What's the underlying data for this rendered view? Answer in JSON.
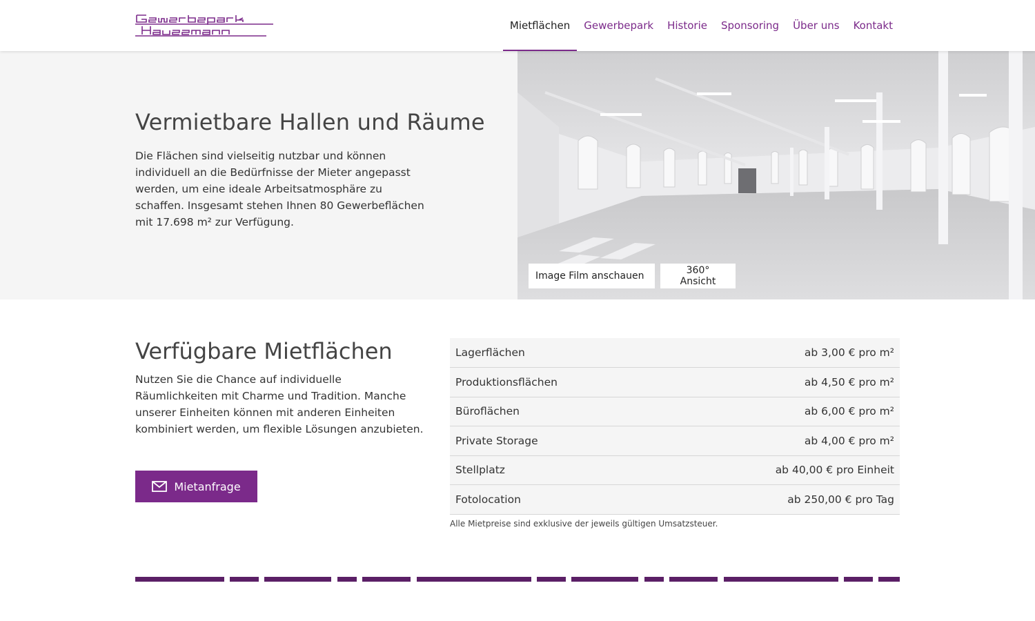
{
  "header": {
    "logo_text": "Gewerbepark Haussmann",
    "nav": [
      {
        "label": "Mietflächen",
        "active": true
      },
      {
        "label": "Gewerbepark",
        "active": false
      },
      {
        "label": "Historie",
        "active": false
      },
      {
        "label": "Sponsoring",
        "active": false
      },
      {
        "label": "Über uns",
        "active": false
      },
      {
        "label": "Kontakt",
        "active": false
      }
    ]
  },
  "hero": {
    "title": "Vermietbare Hallen und Räume",
    "text": "Die Flächen sind vielseitig nutzbar und können individuell an die Bedürfnisse der Mieter angepasst werden, um eine ideale Arbeitsatmosphäre zu schaffen. Insgesamt stehen Ihnen 80 Gewerbeflächen mit 17.698 m² zur Verfügung.",
    "buttons": {
      "film": "Image Film anschauen",
      "view360": "360° Ansicht"
    }
  },
  "available": {
    "title": "Verfügbare Mietflächen",
    "text": "Nutzen Sie die Chance auf individuelle Räumlichkeiten mit Charme und Tradition. Manche unserer Einheiten können mit anderen Einheiten kombiniert werden, um flexible Lösungen anzubieten.",
    "cta_label": "Mietanfrage",
    "cta_icon": "mail-icon",
    "prices": [
      {
        "type": "Lagerflächen",
        "price": "ab 3,00 € pro m²"
      },
      {
        "type": "Produktionsflächen",
        "price": "ab 4,50 € pro m²"
      },
      {
        "type": "Büroflächen",
        "price": "ab 6,00 € pro m²"
      },
      {
        "type": "Private Storage",
        "price": "ab 4,00 € pro m²"
      },
      {
        "type": "Stellplatz",
        "price": "ab 40,00 € pro Einheit"
      },
      {
        "type": "Fotolocation",
        "price": "ab 250,00 € pro Tag"
      }
    ],
    "note": "Alle Mietpreise sind exklusive der jeweils gültigen Umsatzsteuer."
  },
  "colors": {
    "brand": "#7b2a8a",
    "stripe": "#5b1f66"
  }
}
